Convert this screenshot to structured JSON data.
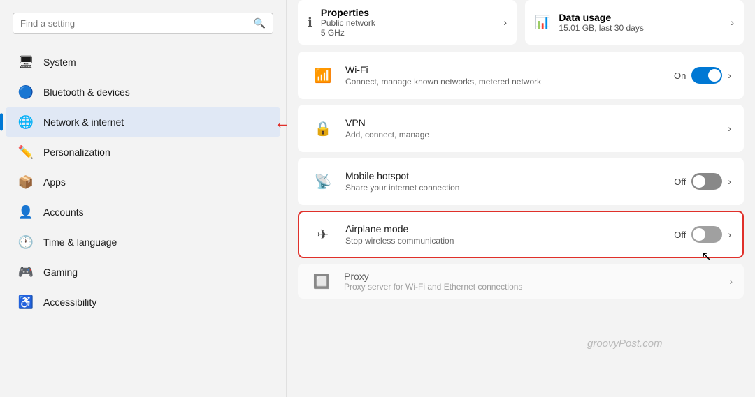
{
  "search": {
    "placeholder": "Find a setting"
  },
  "sidebar": {
    "items": [
      {
        "id": "system",
        "label": "System",
        "icon": "🖥"
      },
      {
        "id": "bluetooth",
        "label": "Bluetooth & devices",
        "icon": "🔵"
      },
      {
        "id": "network",
        "label": "Network & internet",
        "icon": "🌐",
        "active": true
      },
      {
        "id": "personalization",
        "label": "Personalization",
        "icon": "✏️"
      },
      {
        "id": "apps",
        "label": "Apps",
        "icon": "📦"
      },
      {
        "id": "accounts",
        "label": "Accounts",
        "icon": "👤"
      },
      {
        "id": "time",
        "label": "Time & language",
        "icon": "🕐"
      },
      {
        "id": "gaming",
        "label": "Gaming",
        "icon": "🎮"
      },
      {
        "id": "accessibility",
        "label": "Accessibility",
        "icon": "♿"
      }
    ]
  },
  "top_cards": [
    {
      "icon": "ℹ",
      "title": "Properties",
      "sub": "Public network\n5 GHz",
      "has_chevron": true
    },
    {
      "icon": "📊",
      "title": "Data usage",
      "sub": "15.01 GB, last 30 days",
      "has_chevron": true
    }
  ],
  "settings_items": [
    {
      "id": "wifi",
      "icon": "📶",
      "name": "Wi-Fi",
      "desc": "Connect, manage known networks, metered network",
      "status": "On",
      "toggle": "on",
      "has_chevron": true,
      "highlighted": false
    },
    {
      "id": "vpn",
      "icon": "🔒",
      "name": "VPN",
      "desc": "Add, connect, manage",
      "status": "",
      "toggle": null,
      "has_chevron": true,
      "highlighted": false
    },
    {
      "id": "mobile-hotspot",
      "icon": "📡",
      "name": "Mobile hotspot",
      "desc": "Share your internet connection",
      "status": "Off",
      "toggle": "off",
      "has_chevron": true,
      "highlighted": false
    },
    {
      "id": "airplane-mode",
      "icon": "✈",
      "name": "Airplane mode",
      "desc": "Stop wireless communication",
      "status": "Off",
      "toggle": "off-gray",
      "has_chevron": true,
      "highlighted": true
    }
  ],
  "proxy_partial": {
    "icon": "🔲",
    "name": "Proxy",
    "desc": "Proxy server for Wi-Fi and Ethernet connections",
    "has_chevron": true
  },
  "watermark": "groovyPost.com"
}
